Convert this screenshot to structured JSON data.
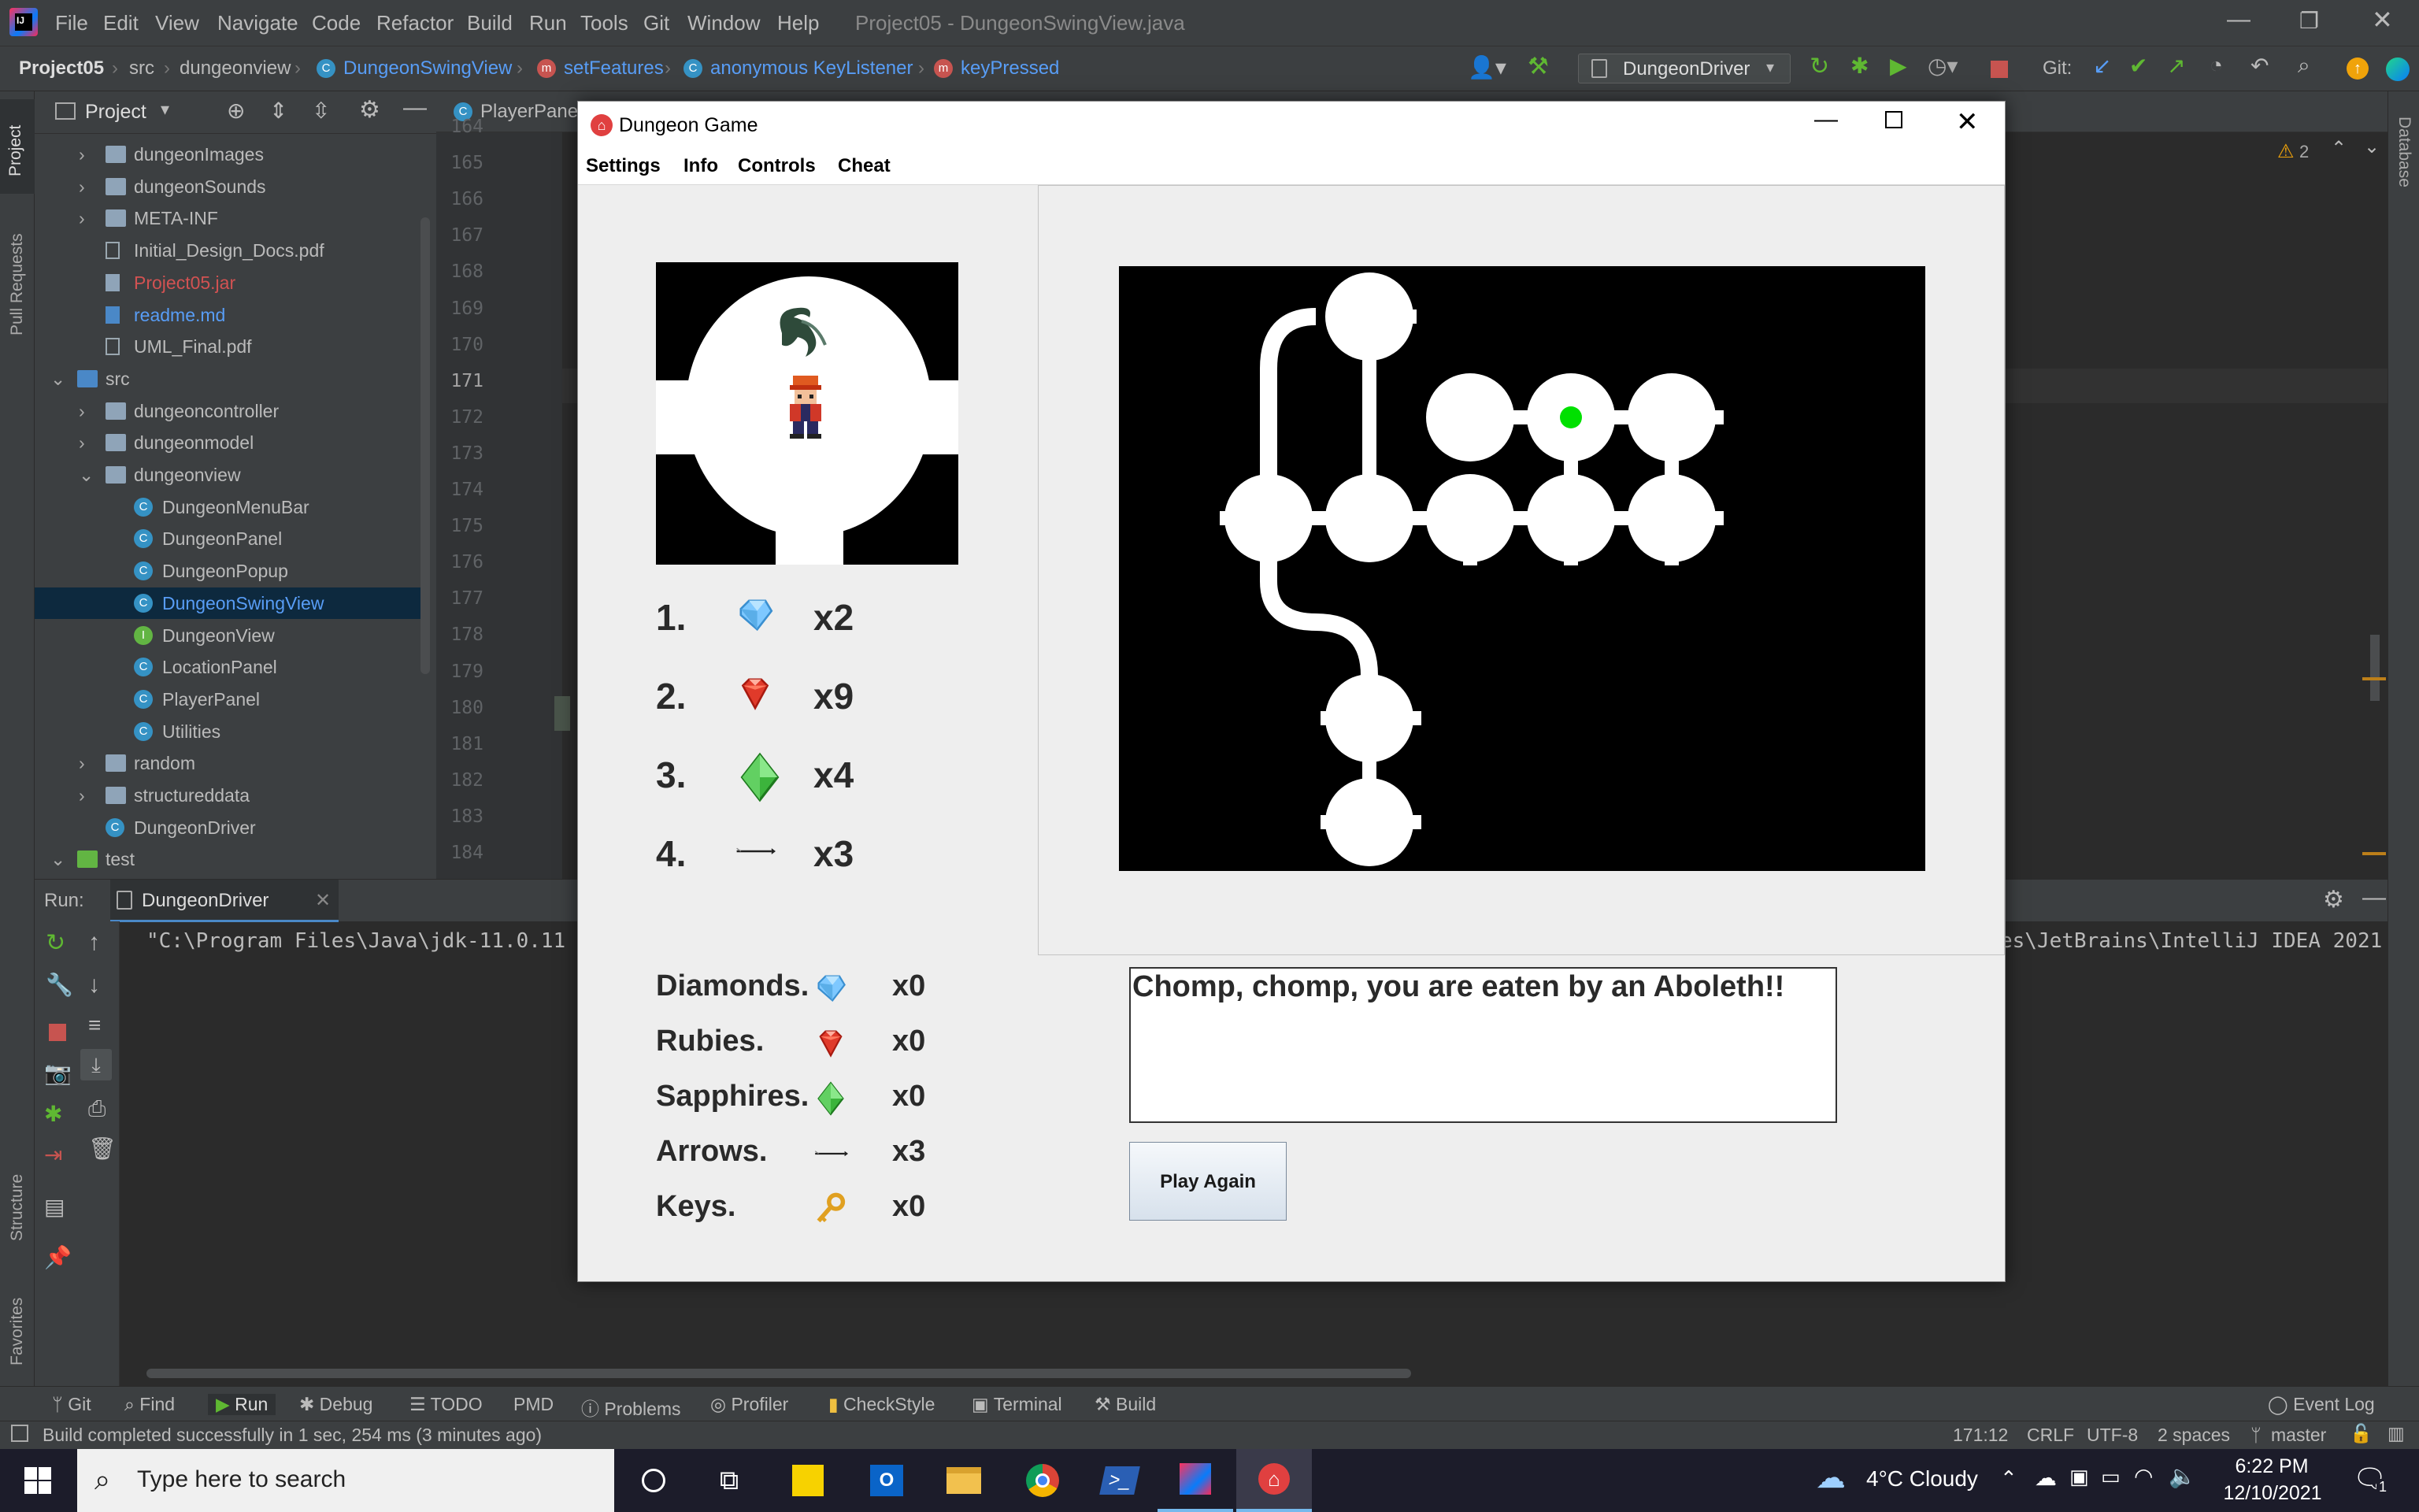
{
  "ide": {
    "menu": [
      "File",
      "Edit",
      "View",
      "Navigate",
      "Code",
      "Refactor",
      "Build",
      "Run",
      "Tools",
      "Git",
      "Window",
      "Help"
    ],
    "title": "Project05 - DungeonSwingView.java",
    "breadcrumbs": [
      "Project05",
      "src",
      "dungeonview",
      "DungeonSwingView",
      "setFeatures",
      "anonymous KeyListener",
      "keyPressed"
    ],
    "run_config": "DungeonDriver",
    "git_label": "Git:",
    "project_header": "Project",
    "editor_tab": "PlayerPanel",
    "warnings_count": "2",
    "side_tabs": {
      "project": "Project",
      "pull_requests": "Pull Requests",
      "structure": "Structure",
      "favorites": "Favorites",
      "database": "Database"
    },
    "tree": [
      {
        "label": "dungeonImages",
        "type": "folder",
        "indent": 1,
        "chevron": "›"
      },
      {
        "label": "dungeonSounds",
        "type": "folder",
        "indent": 1,
        "chevron": "›"
      },
      {
        "label": "META-INF",
        "type": "folder",
        "indent": 1,
        "chevron": "›"
      },
      {
        "label": "Initial_Design_Docs.pdf",
        "type": "file",
        "indent": 1,
        "chevron": ""
      },
      {
        "label": "Project05.jar",
        "type": "jar",
        "indent": 1,
        "chevron": ""
      },
      {
        "label": "readme.md",
        "type": "md",
        "indent": 1,
        "chevron": ""
      },
      {
        "label": "UML_Final.pdf",
        "type": "file",
        "indent": 1,
        "chevron": ""
      },
      {
        "label": "src",
        "type": "srcfolder",
        "indent": 0,
        "chevron": "⌄"
      },
      {
        "label": "dungeoncontroller",
        "type": "folder",
        "indent": 1,
        "chevron": "›"
      },
      {
        "label": "dungeonmodel",
        "type": "folder",
        "indent": 1,
        "chevron": "›"
      },
      {
        "label": "dungeonview",
        "type": "folder",
        "indent": 1,
        "chevron": "⌄"
      },
      {
        "label": "DungeonMenuBar",
        "type": "class",
        "indent": 2,
        "chevron": ""
      },
      {
        "label": "DungeonPanel",
        "type": "class",
        "indent": 2,
        "chevron": ""
      },
      {
        "label": "DungeonPopup",
        "type": "class",
        "indent": 2,
        "chevron": ""
      },
      {
        "label": "DungeonSwingView",
        "type": "class",
        "indent": 2,
        "chevron": "",
        "selected": true
      },
      {
        "label": "DungeonView",
        "type": "interface",
        "indent": 2,
        "chevron": ""
      },
      {
        "label": "LocationPanel",
        "type": "class",
        "indent": 2,
        "chevron": ""
      },
      {
        "label": "PlayerPanel",
        "type": "class",
        "indent": 2,
        "chevron": ""
      },
      {
        "label": "Utilities",
        "type": "class",
        "indent": 2,
        "chevron": ""
      },
      {
        "label": "random",
        "type": "folder",
        "indent": 1,
        "chevron": "›"
      },
      {
        "label": "structureddata",
        "type": "folder",
        "indent": 1,
        "chevron": "›"
      },
      {
        "label": "DungeonDriver",
        "type": "class",
        "indent": 1,
        "chevron": ""
      },
      {
        "label": "test",
        "type": "testfolder",
        "indent": 0,
        "chevron": "⌄"
      },
      {
        "label": "DungeonAsyncControllerTest",
        "type": "class",
        "indent": 1,
        "chevron": ""
      }
    ],
    "line_numbers": [
      "164",
      "165",
      "166",
      "167",
      "168",
      "169",
      "170",
      "171",
      "172",
      "173",
      "174",
      "175",
      "176",
      "177",
      "178",
      "179",
      "180",
      "181",
      "182",
      "183",
      "184"
    ],
    "current_line": "171",
    "run_label": "Run:",
    "run_tab": "DungeonDriver",
    "console_left": "\"C:\\Program Files\\Java\\jdk-11.0.11",
    "console_right": "es\\JetBrains\\IntelliJ IDEA 2021",
    "bottom_tabs": [
      "Git",
      "Find",
      "Run",
      "Debug",
      "TODO",
      "PMD",
      "Problems",
      "Profiler",
      "CheckStyle",
      "Terminal",
      "Build"
    ],
    "event_log": "Event Log",
    "status_text": "Build completed successfully in 1 sec, 254 ms (3 minutes ago)",
    "status_right": [
      "171:12",
      "CRLF",
      "UTF-8",
      "2 spaces",
      "master"
    ]
  },
  "dungeon_window": {
    "title": "Dungeon Game",
    "menu": [
      "Settings",
      "Info",
      "Controls",
      "Cheat"
    ],
    "location_items": [
      {
        "num": "1.",
        "item": "diamond-icon",
        "count": "x2"
      },
      {
        "num": "2.",
        "item": "ruby-icon",
        "count": "x9"
      },
      {
        "num": "3.",
        "item": "sapphire-icon",
        "count": "x4"
      },
      {
        "num": "4.",
        "item": "arrow-icon",
        "count": "x3"
      }
    ],
    "player_stats": [
      {
        "label": "Diamonds.",
        "icon": "diamond-icon",
        "count": "x0"
      },
      {
        "label": "Rubies.",
        "icon": "ruby-icon",
        "count": "x0"
      },
      {
        "label": "Sapphires.",
        "icon": "sapphire-icon",
        "count": "x0"
      },
      {
        "label": "Arrows.",
        "icon": "arrow-icon",
        "count": "x3"
      },
      {
        "label": "Keys.",
        "icon": "key-icon",
        "count": "x0"
      }
    ],
    "message": "Chomp, chomp, you are eaten by an Aboleth!!",
    "play_again": "Play Again",
    "colors": {
      "player_marker": "#00e000",
      "room": "#ffffff",
      "background": "#000000"
    }
  },
  "taskbar": {
    "search_placeholder": "Type here to search",
    "weather": "4°C  Cloudy",
    "time": "6:22 PM",
    "date": "12/10/2021",
    "notification_count": "1"
  }
}
